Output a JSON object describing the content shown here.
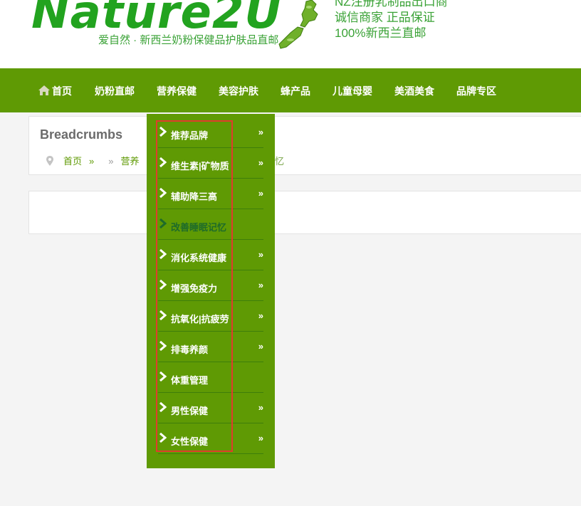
{
  "header": {
    "logo_text": "Nature2U",
    "slogan": "爱自然 · 新西兰奶粉保健品护肤品直邮",
    "tagline": [
      "NZ注册乳制品出口商",
      "诚信商家 正品保证",
      "100%新西兰直邮"
    ]
  },
  "nav": {
    "items": [
      {
        "label": "首页",
        "icon": "home-icon"
      },
      {
        "label": "奶粉直邮"
      },
      {
        "label": "营养保健"
      },
      {
        "label": "美容护肤"
      },
      {
        "label": "蜂产品"
      },
      {
        "label": "儿童母婴"
      },
      {
        "label": "美酒美食"
      },
      {
        "label": "品牌专区"
      }
    ]
  },
  "breadcrumbs": {
    "title": "Breadcrumbs",
    "home": "首页",
    "sep": "»",
    "level2": "营养",
    "current": "忆"
  },
  "dropdown": {
    "items": [
      {
        "label": "推荐品牌",
        "has_submenu": true,
        "active": false
      },
      {
        "label": "维生素|矿物质",
        "has_submenu": true,
        "active": false
      },
      {
        "label": "辅助降三高",
        "has_submenu": true,
        "active": false
      },
      {
        "label": "改善睡眠记忆",
        "has_submenu": false,
        "active": true
      },
      {
        "label": "消化系统健康",
        "has_submenu": true,
        "active": false
      },
      {
        "label": "增强免疫力",
        "has_submenu": true,
        "active": false
      },
      {
        "label": "抗氧化|抗疲劳",
        "has_submenu": true,
        "active": false
      },
      {
        "label": "排毒养颜",
        "has_submenu": true,
        "active": false
      },
      {
        "label": "体重管理",
        "has_submenu": false,
        "active": false
      },
      {
        "label": "男性保健",
        "has_submenu": true,
        "active": false
      },
      {
        "label": "女性保健",
        "has_submenu": true,
        "active": false
      }
    ],
    "chevron": "»"
  },
  "colors": {
    "nav_bg": "#5f9a04",
    "brand_green": "#22a31f",
    "highlight_box": "#e03c2c",
    "active_text": "#1e6b2a"
  }
}
